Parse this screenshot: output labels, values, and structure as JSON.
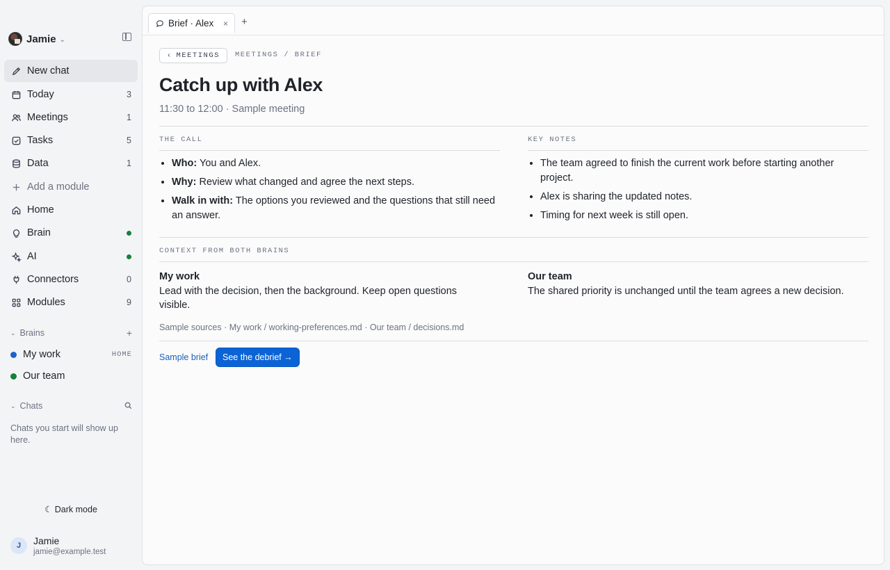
{
  "workspace": {
    "name": "Jamie"
  },
  "nav": [
    {
      "label": "New chat",
      "count": "",
      "icon": "pencil-icon",
      "active": true
    },
    {
      "label": "Today",
      "count": "3",
      "icon": "calendar-icon"
    },
    {
      "label": "Meetings",
      "count": "1",
      "icon": "people-icon"
    },
    {
      "label": "Tasks",
      "count": "5",
      "icon": "checkbox-icon"
    },
    {
      "label": "Data",
      "count": "1",
      "icon": "database-icon"
    },
    {
      "label": "Add a module",
      "count": "",
      "icon": "plus-icon"
    },
    {
      "label": "Home",
      "count": "",
      "icon": "home-icon"
    },
    {
      "label": "Brain",
      "status": "online",
      "icon": "lightbulb-icon"
    },
    {
      "label": "AI",
      "status": "online",
      "icon": "sparkle-icon"
    },
    {
      "label": "Connectors",
      "count": "0",
      "icon": "plug-icon"
    },
    {
      "label": "Modules",
      "count": "9",
      "icon": "grid-icon"
    }
  ],
  "brains_section": {
    "title": "Brains",
    "items": [
      {
        "name": "My work",
        "tag": "HOME",
        "color": "#1b63c9"
      },
      {
        "name": "Our team",
        "tag": "",
        "color": "#15803d"
      }
    ]
  },
  "chats_section": {
    "title": "Chats",
    "empty_text": "Chats you start will show up here."
  },
  "dark_mode_label": "Dark mode",
  "user": {
    "initial": "J",
    "name": "Jamie",
    "email": "jamie@example.test"
  },
  "tab": {
    "label": "Brief · Alex",
    "close": "×",
    "add": "+"
  },
  "back_button": "MEETINGS",
  "breadcrumb": "MEETINGS / BRIEF",
  "title": "Catch up with Alex",
  "subtitle": "11:30 to 12:00 · Sample meeting",
  "the_call": {
    "label": "THE CALL",
    "items": [
      {
        "key": "Who:",
        "text": " You and Alex."
      },
      {
        "key": "Why:",
        "text": " Review what changed and agree the next steps."
      },
      {
        "key": "Walk in with:",
        "text": " The options you reviewed and the questions that still need an answer."
      }
    ]
  },
  "key_notes": {
    "label": "KEY NOTES",
    "items": [
      "The team agreed to finish the current work before starting another project.",
      "Alex is sharing the updated notes.",
      "Timing for next week is still open."
    ]
  },
  "context": {
    "label": "CONTEXT FROM BOTH BRAINS",
    "my_work": {
      "title": "My work",
      "text": "Lead with the decision, then the background. Keep open questions visible."
    },
    "our_team": {
      "title": "Our team",
      "text": "The shared priority is unchanged until the team agrees a new decision."
    },
    "sources": "Sample sources · My work / working-preferences.md · Our team / decisions.md"
  },
  "footer": {
    "link": "Sample brief",
    "button": "See the debrief →"
  }
}
